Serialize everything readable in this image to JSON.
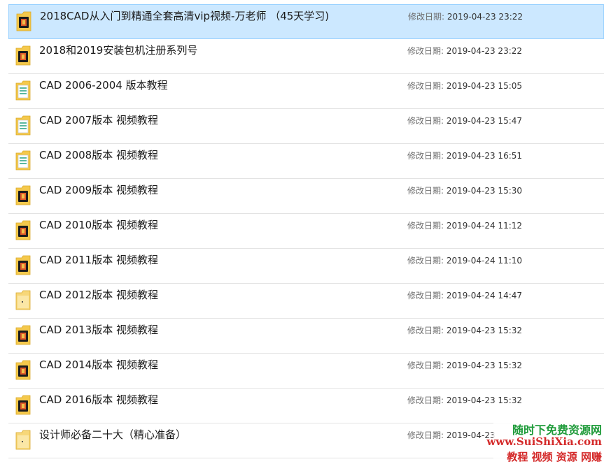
{
  "list": {
    "items": [
      {
        "name": "2018CAD从入门到精通全套高清vip视频-万老师 （45天学习)",
        "modified_label": "修改日期:",
        "modified_value": "2019-04-23 23:22",
        "icon": "folder-video-icon",
        "selected": true
      },
      {
        "name": "2018和2019安装包机注册系列号",
        "modified_label": "修改日期:",
        "modified_value": "2019-04-23 23:22",
        "icon": "folder-video-icon",
        "selected": false
      },
      {
        "name": "CAD 2006-2004 版本教程",
        "modified_label": "修改日期:",
        "modified_value": "2019-04-23 15:05",
        "icon": "folder-doc-icon",
        "selected": false
      },
      {
        "name": "CAD 2007版本 视频教程",
        "modified_label": "修改日期:",
        "modified_value": "2019-04-23 15:47",
        "icon": "folder-doc-icon",
        "selected": false
      },
      {
        "name": "CAD 2008版本  视频教程",
        "modified_label": "修改日期:",
        "modified_value": "2019-04-23 16:51",
        "icon": "folder-doc-icon",
        "selected": false
      },
      {
        "name": "CAD 2009版本  视频教程",
        "modified_label": "修改日期:",
        "modified_value": "2019-04-23 15:30",
        "icon": "folder-video-icon",
        "selected": false
      },
      {
        "name": "CAD 2010版本  视频教程",
        "modified_label": "修改日期:",
        "modified_value": "2019-04-24 11:12",
        "icon": "folder-video-icon",
        "selected": false
      },
      {
        "name": "CAD 2011版本  视频教程",
        "modified_label": "修改日期:",
        "modified_value": "2019-04-24 11:10",
        "icon": "folder-video-icon",
        "selected": false
      },
      {
        "name": "CAD 2012版本  视频教程",
        "modified_label": "修改日期:",
        "modified_value": "2019-04-24 14:47",
        "icon": "folder-empty-icon",
        "selected": false
      },
      {
        "name": "CAD 2013版本  视频教程",
        "modified_label": "修改日期:",
        "modified_value": "2019-04-23 15:32",
        "icon": "folder-video-icon",
        "selected": false
      },
      {
        "name": "CAD 2014版本 视频教程",
        "modified_label": "修改日期:",
        "modified_value": "2019-04-23 15:32",
        "icon": "folder-video-icon",
        "selected": false
      },
      {
        "name": "CAD 2016版本 视频教程",
        "modified_label": "修改日期:",
        "modified_value": "2019-04-23 15:32",
        "icon": "folder-video-icon",
        "selected": false
      },
      {
        "name": "设计师必备二十大（精心准备）",
        "modified_label": "修改日期:",
        "modified_value": "2019-04-23",
        "icon": "folder-empty-icon",
        "selected": false
      }
    ]
  },
  "watermark": {
    "line1": "随时下免费资源网",
    "line2": "www.SuiShiXia.com",
    "line3": "教程 视频 资源 网赚"
  },
  "colors": {
    "selection_bg": "#cce8ff",
    "selection_border": "#99d1ff",
    "folder_yellow": "#f5c94c",
    "watermark_green": "#1f9b3a",
    "watermark_red": "#d42a2a"
  }
}
